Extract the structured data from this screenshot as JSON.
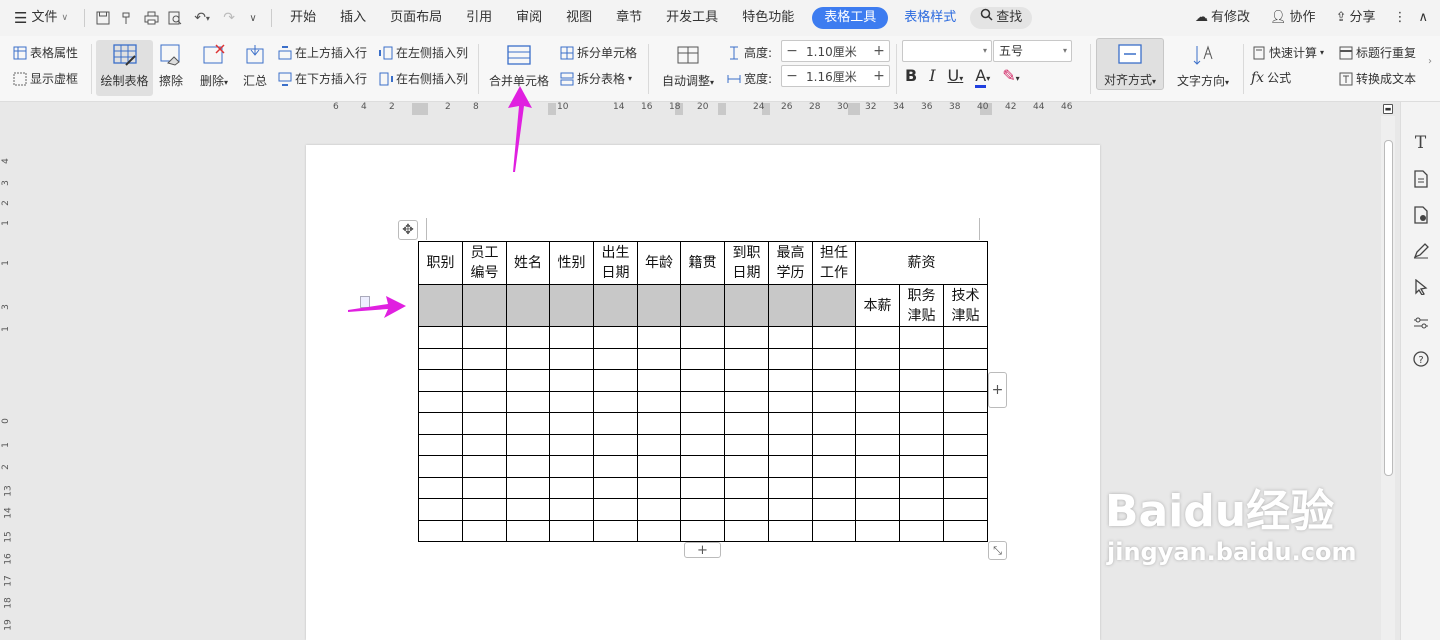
{
  "menubar": {
    "file_label": "文件",
    "tabs": [
      "开始",
      "插入",
      "页面布局",
      "引用",
      "审阅",
      "视图",
      "章节",
      "开发工具",
      "特色功能"
    ],
    "active_tab": "表格工具",
    "blue_tab": "表格样式",
    "search_label": "查找",
    "right": {
      "modify": "有修改",
      "collab": "协作",
      "share": "分享"
    }
  },
  "ribbon": {
    "table_props": "表格属性",
    "show_gridlines": "显示虚框",
    "draw_table": "绘制表格",
    "erase": "擦除",
    "delete": "删除",
    "summary": "汇总",
    "insert_row_above": "在上方插入行",
    "insert_row_below": "在下方插入行",
    "insert_col_left": "在左侧插入列",
    "insert_col_right": "在右侧插入列",
    "merge_cells": "合并单元格",
    "split_cells": "拆分单元格",
    "split_table": "拆分表格",
    "auto_adjust": "自动调整",
    "height_label": "高度:",
    "height_value": "1.10厘米",
    "width_label": "宽度:",
    "width_value": "1.16厘米",
    "font_name": "",
    "font_size": "五号",
    "align": "对齐方式",
    "text_dir": "文字方向",
    "quick_calc": "快速计算",
    "repeat_header": "标题行重复",
    "formula": "公式",
    "to_text": "转换成文本"
  },
  "ruler": {
    "h_numbers": [
      "6",
      "4",
      "2",
      "2",
      "8",
      "10",
      "14",
      "16",
      "18",
      "20",
      "24",
      "26",
      "28",
      "30",
      "32",
      "34",
      "36",
      "38",
      "40",
      "42",
      "44",
      "46"
    ],
    "v_numbers": [
      "4",
      "3",
      "2",
      "1",
      "1",
      "3",
      "1",
      "0",
      "1",
      "2",
      "13",
      "14",
      "15",
      "16",
      "17",
      "18",
      "19"
    ]
  },
  "table": {
    "header": [
      "职别",
      "员工编号",
      "姓名",
      "性别",
      "出生日期",
      "年龄",
      "籍贯",
      "到职日期",
      "最高学历",
      "担任工作"
    ],
    "salary_label": "薪资",
    "sub_headers": [
      "本薪",
      "职务津贴",
      "技术津贴"
    ],
    "empty_rows": 10
  },
  "watermark": {
    "brand": "Baidu经验",
    "url": "jingyan.baidu.com"
  }
}
